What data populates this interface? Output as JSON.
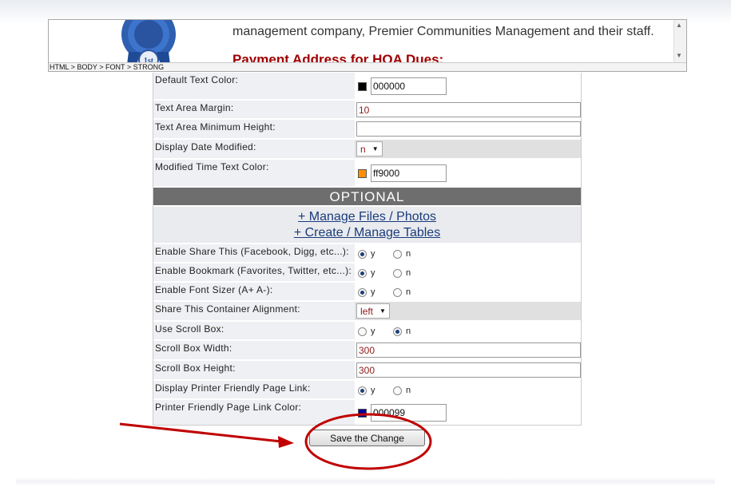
{
  "preview": {
    "line1": "management company, Premier Communities Management and their staff.",
    "heading": "Payment Address for HOA Dues:",
    "breadcrumb": "HTML > BODY > FONT > STRONG",
    "ribbon_text": "1st"
  },
  "fields": {
    "default_text_color": {
      "label": "Default Text Color:",
      "value": "000000",
      "swatch": "#000000"
    },
    "text_area_margin": {
      "label": "Text Area Margin:",
      "value": "10"
    },
    "text_area_min_height": {
      "label": "Text Area Minimum Height:",
      "value": ""
    },
    "display_date_modified": {
      "label": "Display Date Modified:",
      "value": "n"
    },
    "modified_time_color": {
      "label": "Modified Time Text Color:",
      "value": "ff9000",
      "swatch": "#ff9000"
    }
  },
  "optional": {
    "title": "OPTIONAL",
    "manage_files": "+ Manage Files / Photos",
    "manage_tables": "+ Create / Manage Tables"
  },
  "opts": {
    "share_this": {
      "label": "Enable Share This (Facebook, Digg, etc...):",
      "y": "y",
      "n": "n",
      "selected": "y"
    },
    "bookmark": {
      "label": "Enable Bookmark (Favorites, Twitter, etc...):",
      "y": "y",
      "n": "n",
      "selected": "y"
    },
    "font_sizer": {
      "label": "Enable Font Sizer (A+ A-):",
      "y": "y",
      "n": "n",
      "selected": "y"
    },
    "share_align": {
      "label": "Share This Container Alignment:",
      "value": "left"
    },
    "scroll_box": {
      "label": "Use Scroll Box:",
      "y": "y",
      "n": "n",
      "selected": "n"
    },
    "scroll_width": {
      "label": "Scroll Box Width:",
      "value": "300"
    },
    "scroll_height": {
      "label": "Scroll Box Height:",
      "value": "300"
    },
    "printer_link": {
      "label": "Display Printer Friendly Page Link:",
      "y": "y",
      "n": "n",
      "selected": "y"
    },
    "printer_color": {
      "label": "Printer Friendly Page Link Color:",
      "value": "000099",
      "swatch": "#000099"
    }
  },
  "save_label": "Save the Change",
  "colors": {
    "annotation": "#c00000",
    "optional_bar": "#6e6e6e",
    "link": "#1a3b7c"
  }
}
